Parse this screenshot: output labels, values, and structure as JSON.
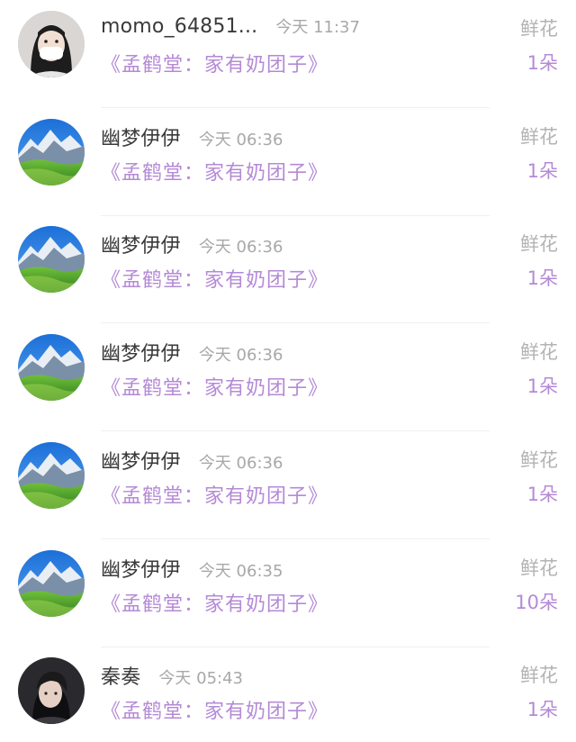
{
  "records": [
    {
      "avatar": "girl-masked-avatar",
      "username": "momo_64851...",
      "time": "今天 11:37",
      "book": "《孟鹤堂：家有奶团子》",
      "gift": "鲜花",
      "count": "1朵"
    },
    {
      "avatar": "mountain-landscape-avatar",
      "username": "幽梦伊伊",
      "time": "今天 06:36",
      "book": "《孟鹤堂：家有奶团子》",
      "gift": "鲜花",
      "count": "1朵"
    },
    {
      "avatar": "mountain-landscape-avatar",
      "username": "幽梦伊伊",
      "time": "今天 06:36",
      "book": "《孟鹤堂：家有奶团子》",
      "gift": "鲜花",
      "count": "1朵"
    },
    {
      "avatar": "mountain-landscape-avatar",
      "username": "幽梦伊伊",
      "time": "今天 06:36",
      "book": "《孟鹤堂：家有奶团子》",
      "gift": "鲜花",
      "count": "1朵"
    },
    {
      "avatar": "mountain-landscape-avatar",
      "username": "幽梦伊伊",
      "time": "今天 06:36",
      "book": "《孟鹤堂：家有奶团子》",
      "gift": "鲜花",
      "count": "1朵"
    },
    {
      "avatar": "mountain-landscape-avatar",
      "username": "幽梦伊伊",
      "time": "今天 06:35",
      "book": "《孟鹤堂：家有奶团子》",
      "gift": "鲜花",
      "count": "10朵"
    },
    {
      "avatar": "man-portrait-avatar",
      "username": "秦奏",
      "time": "今天 05:43",
      "book": "《孟鹤堂：家有奶团子》",
      "gift": "鲜花",
      "count": "1朵"
    }
  ],
  "colors": {
    "accent_purple": "#b48ad6",
    "muted_gray": "#a8a8a8",
    "name_text": "#3a3a3a"
  }
}
